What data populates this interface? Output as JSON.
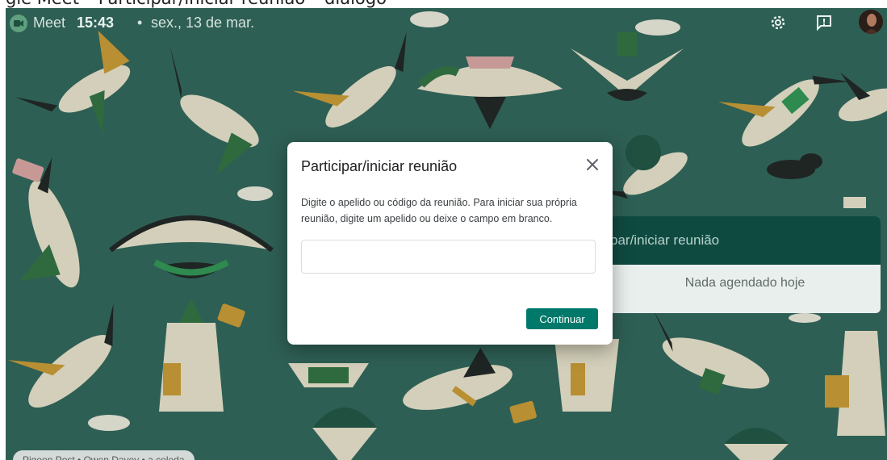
{
  "topbar": {
    "app_name": "Meet",
    "time": "15:43",
    "separator": "•",
    "date": "sex., 13 de mar."
  },
  "right_card": {
    "primary_label": "par/iniciar reunião",
    "empty_label": "Nada agendado hoje"
  },
  "attribution": "Pigeon Post • Owen Davey • a coleda",
  "modal": {
    "title": "Participar/iniciar reunião",
    "description": "Digite o apelido ou código da reunião. Para iniciar sua própria reunião, digite um apelido ou deixe o campo em branco.",
    "input_value": "",
    "continue_label": "Continuar"
  },
  "colors": {
    "background": "#2e5f54",
    "accent": "#00796b",
    "card_dark": "#0f4a41"
  },
  "icons": [
    "meet-logo-icon",
    "gear-icon",
    "feedback-icon",
    "close-icon"
  ]
}
